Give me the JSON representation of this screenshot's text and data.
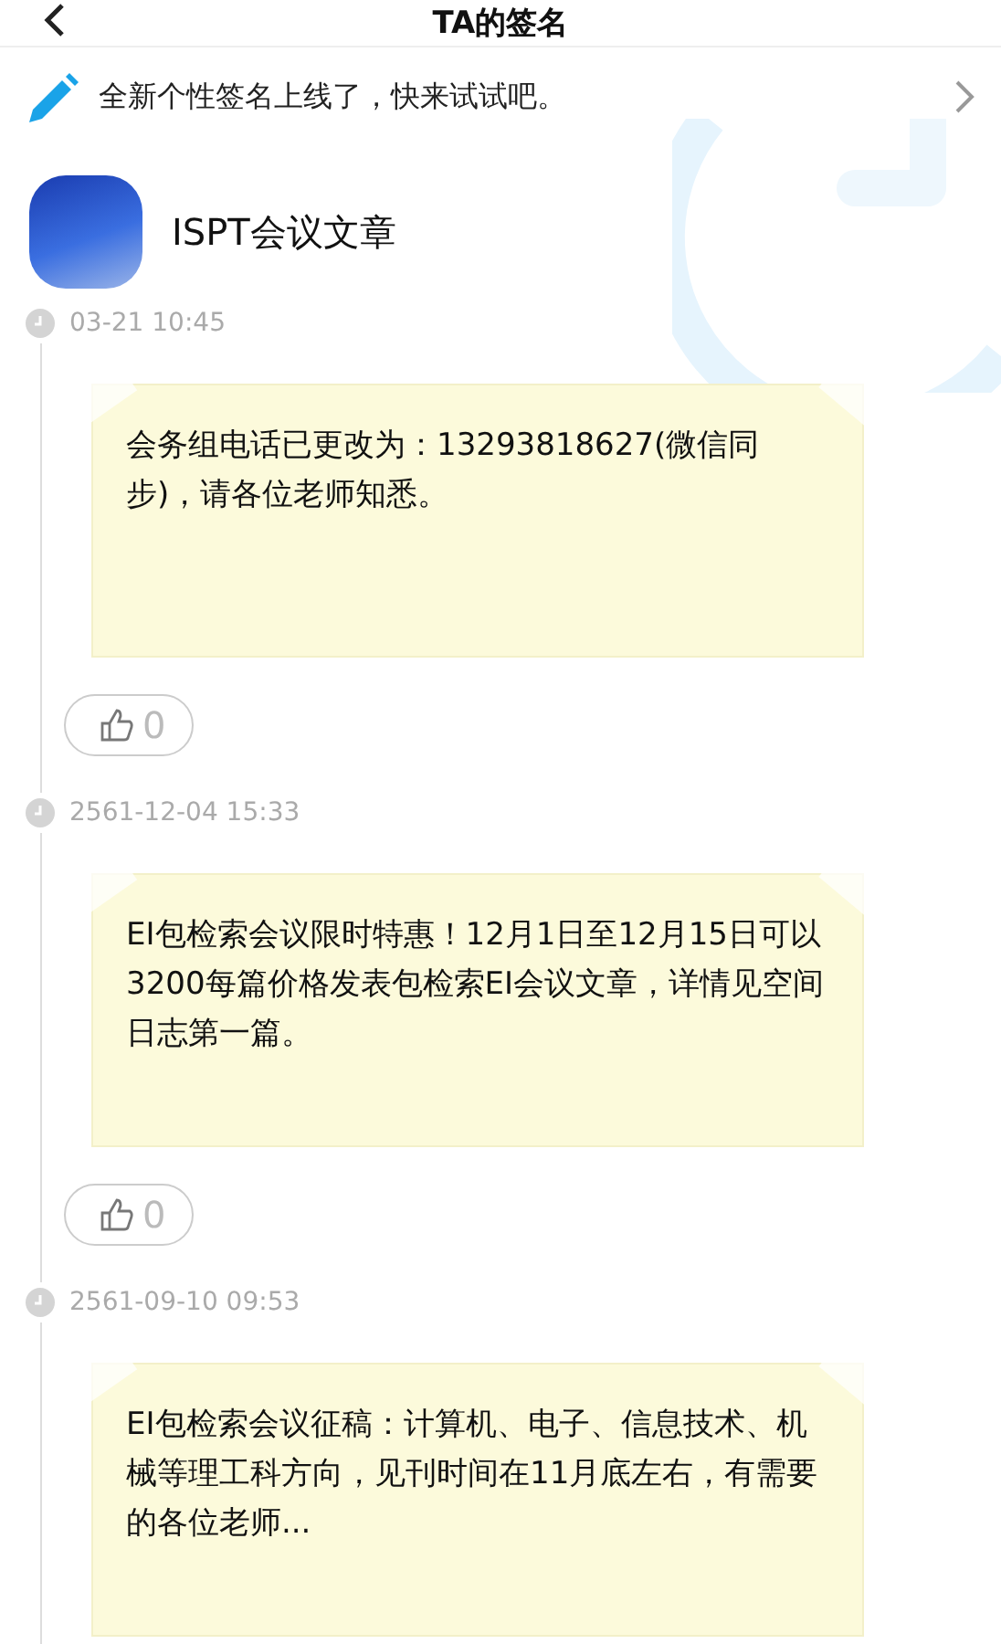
{
  "header": {
    "title": "TA的签名"
  },
  "banner": {
    "text": "全新个性签名上线了，快来试试吧。"
  },
  "profile": {
    "name": "ISPT会议文章"
  },
  "posts": [
    {
      "time": "03-21 10:45",
      "text": "会务组电话已更改为：13293818627(微信同步)，请各位老师知悉。",
      "likes": "0"
    },
    {
      "time": "2561-12-04 15:33",
      "text": "EI包检索会议限时特惠！12月1日至12月15日可以3200每篇价格发表包检索EI会议文章，详情见空间日志第一篇。",
      "likes": "0"
    },
    {
      "time": "2561-09-10 09:53",
      "text": "EI包检索会议征稿：计算机、电子、信息技术、机械等理工科方向，见刊时间在11月底左右，有需要的各位老师..."
    }
  ]
}
